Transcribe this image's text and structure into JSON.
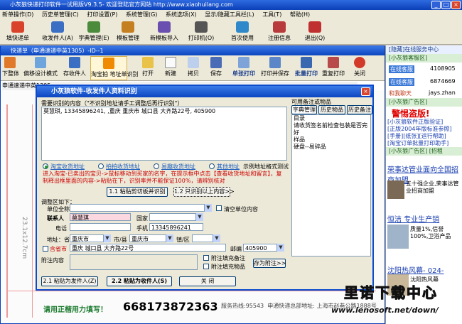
{
  "app": {
    "title": "小灰狼快递打印软件一试用版V9.3.5- 欢迎登陆官方网站 http://www.xiaohuilang.com"
  },
  "menu": [
    "新单操作(D)",
    "历史单管理(C)",
    "打印设置(P)",
    "系统管理(G)",
    "系统选项(X)",
    "显示/隐藏工具栏(L)",
    "工具(T)",
    "帮助(H)"
  ],
  "toolbar": {
    "items": [
      {
        "label": "填快递单",
        "icon": "express-form-icon",
        "color": "#d9432b"
      },
      {
        "label": "收发件人(A)",
        "icon": "contacts-icon",
        "color": "#3b6fc4"
      },
      {
        "label": "字典管理(E)",
        "icon": "dictionary-icon",
        "color": "#4d8b3c"
      },
      {
        "label": "模板管理",
        "icon": "template-icon",
        "color": "#c47f20"
      },
      {
        "label": "新模板导入",
        "icon": "template-import-icon",
        "color": "#6a4fb0"
      },
      {
        "label": "打印机(O)",
        "icon": "printer-icon",
        "color": "#555555"
      },
      {
        "label": "首次使用",
        "icon": "first-use-icon",
        "color": "#2e88c9"
      },
      {
        "label": "注册信息",
        "icon": "register-icon",
        "color": "#b83a3a"
      },
      {
        "label": "退出(Q)",
        "icon": "exit-icon",
        "color": "#c03030"
      }
    ]
  },
  "child_window": {
    "title": "快递单（申通速递中英1305）-ID--1",
    "route": "申通速递中英1305",
    "toolbar": [
      {
        "label": "下整体",
        "icon": "move-down-icon"
      },
      {
        "label": "偏移设计模式",
        "icon": "offset-design-icon"
      },
      {
        "label": "存收件人",
        "icon": "save-recipient-icon"
      },
      {
        "label": "淘宝拍 地址单识别",
        "icon": "taobao-recognize-icon"
      },
      {
        "label": "打开",
        "icon": "open-icon"
      },
      {
        "label": "新建",
        "icon": "new-icon"
      },
      {
        "label": "拷贝",
        "icon": "copy-icon"
      },
      {
        "label": "保存",
        "icon": "save-icon"
      },
      {
        "label": "单张打印",
        "icon": "print-single-icon"
      },
      {
        "label": "打印并保存",
        "icon": "print-save-icon"
      },
      {
        "label": "批量打印",
        "icon": "batch-print-icon"
      },
      {
        "label": "重复打印",
        "icon": "reprint-icon"
      },
      {
        "label": "关闭",
        "icon": "close-window-icon"
      }
    ],
    "vertical_date": "23.1x12.7cm",
    "phone_big": "668173872363",
    "bottom_note": "请用正楷用力填写！",
    "bottom_hint_1": "服务热线:95543",
    "bottom_hint_2": "申通快递总部地址: 上海市赵巷公路1888号"
  },
  "dialog": {
    "title": "小灰狼软件-收发件人资料识别",
    "paste_label": "需要识别的内容（\"不识别地址请手工调整后再行识别\"）",
    "paste_value": "莫慧琪, 13345896241, ,重庆 重庆市 城口县 大齐路22号, 405900",
    "tabs": [
      "字典管理",
      "历史物品",
      "历史备注"
    ],
    "dict_title": "可用备注或物品",
    "dict_items": [
      "目录",
      "请收货签名前检查包装是否完好",
      "样品",
      "硬盘--易碎品"
    ],
    "radios": [
      {
        "label": "淘宝收货地址",
        "selected": true
      },
      {
        "label": "拍拍收货地址",
        "selected": false
      },
      {
        "label": "易趣收货地址",
        "selected": false
      },
      {
        "label": "其他地址",
        "selected": false
      }
    ],
    "example_link": "示例地址格式测试",
    "notice": "进入淘宝-已卖出的宝贝->鼠标移动到买家的名字，在提示框中点击【查看收货地址和留言】，复制释出框里面的内容->粘贴在下，识别率并不能保证100%，请辨别核对",
    "btn_paste_recognize": "1.1 粘贴剪切板并识别",
    "btn_only_recognize": "1.2 只识别以上内容>>",
    "adjust_title": "调整区如下：",
    "unit_label": "单位全称",
    "unit_value": "",
    "clear_unit": "清空单位内容",
    "contact_label": "联系人",
    "contact_value": "莫慧琪",
    "country_label": "国家",
    "country_value": "",
    "phone_label": "电话",
    "phone_value": "",
    "mobile_label": "手机",
    "mobile_value": "13345896241",
    "address_label": "地址：省",
    "province_value": "重庆市",
    "city_label": "市/县",
    "city_value": "重庆市",
    "district_label": "镇/区",
    "district_value": "",
    "contains_city": "含省市",
    "street_value": "重庆  城口县  大齐路22号",
    "zip_label": "邮编",
    "zip_value": "405900",
    "remark_label": "附注内容",
    "append_remark": "附注填充备注",
    "append_item": "附注填充物品",
    "save_as_item": "存为附注>>",
    "btn_sender": "2.1 粘贴为发件人(Z)",
    "btn_recipient": "2.2 粘贴为收件人(S)",
    "btn_close": "关  闭"
  },
  "right_panel": {
    "header": "[隐藏]在线服务中心",
    "qq_header": "[小灰狼客服区]",
    "qq": [
      {
        "label": "在线客服",
        "number": "4108905"
      },
      {
        "label": "在线客服",
        "number": "6874669"
      },
      {
        "label": "和我聊天",
        "number": "jays.zhan"
      }
    ],
    "ad_header": "[小灰狼广告区]",
    "ad_title": "警惕盗版!",
    "links": [
      "[小灰狼软件正版验证]",
      "[正版2004年版标准参照]",
      "[手册][纸张][运行帮助]",
      "[淘宝订单批量打印助手]"
    ],
    "ad_header2": "[小灰狼广告区]",
    "ad_link": "[招租",
    "news1": "荣事达管业面向全国招商加盟",
    "news1_sub": "五十强企业,荣事达管业招商加盟",
    "news2": "恒洁 专业生产销",
    "news2_sub": "质量1%,信誉100%,卫浴产品",
    "news3": "沈阳热风幕- 024-",
    "news3_sub": "沈阳热风幕"
  },
  "watermark": {
    "cn": "里诺下载中心",
    "url": "www.lenosoft.net/down/"
  }
}
